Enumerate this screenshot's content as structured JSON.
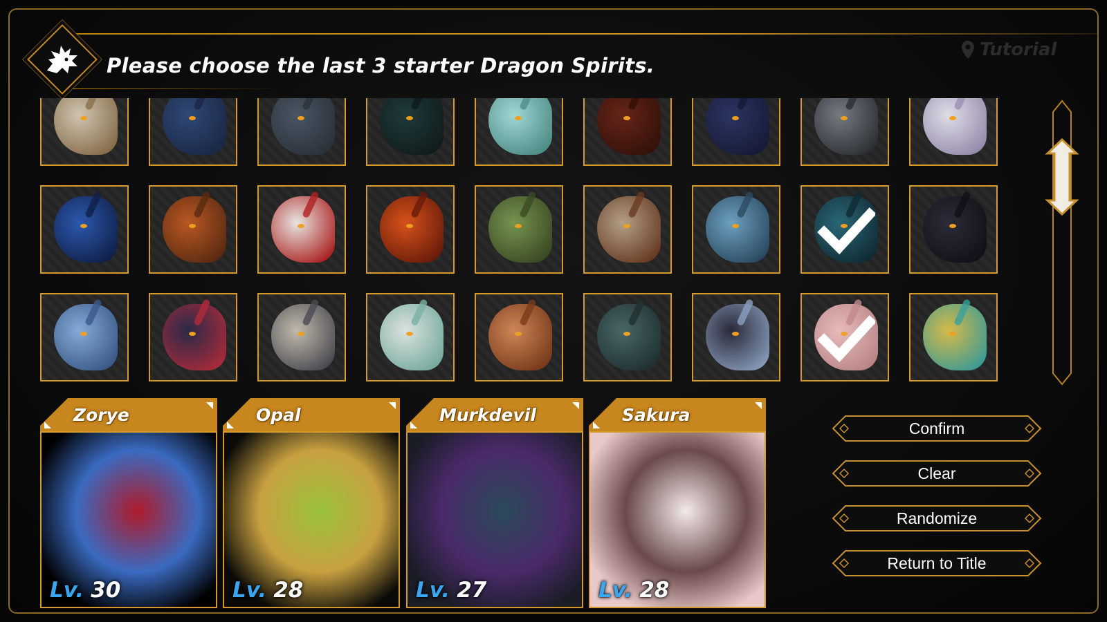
{
  "header": {
    "title": "Please choose the last 3 starter Dragon Spirits.",
    "tutorial_label": "Tutorial"
  },
  "grid": {
    "rows": [
      [
        {
          "name": "dragon-1-1",
          "palette": [
            "#d8cdb8",
            "#8a6f4a"
          ],
          "selected": false
        },
        {
          "name": "dragon-1-2",
          "palette": [
            "#2f4a7a",
            "#1a2746"
          ],
          "selected": false
        },
        {
          "name": "dragon-1-3",
          "palette": [
            "#4b5866",
            "#2a323b"
          ],
          "selected": false
        },
        {
          "name": "dragon-1-4",
          "palette": [
            "#1f3b3a",
            "#0f1a1c"
          ],
          "selected": false
        },
        {
          "name": "dragon-1-5",
          "palette": [
            "#a6e0dc",
            "#4f8f8a"
          ],
          "selected": false
        },
        {
          "name": "dragon-1-6",
          "palette": [
            "#6a2418",
            "#321008"
          ],
          "selected": false
        },
        {
          "name": "dragon-1-7",
          "palette": [
            "#2b3566",
            "#151a36"
          ],
          "selected": false
        },
        {
          "name": "dragon-1-8",
          "palette": [
            "#7a7f86",
            "#2b2f34"
          ],
          "selected": false
        },
        {
          "name": "dragon-1-9",
          "palette": [
            "#e8e6f0",
            "#9a8fb2"
          ],
          "selected": false
        }
      ],
      [
        {
          "name": "dragon-2-1",
          "palette": [
            "#2c5bb5",
            "#0f1f4a"
          ],
          "selected": false
        },
        {
          "name": "dragon-2-2",
          "palette": [
            "#c25a22",
            "#5a2a10"
          ],
          "selected": false
        },
        {
          "name": "dragon-2-3",
          "palette": [
            "#f2efea",
            "#b02020"
          ],
          "selected": false
        },
        {
          "name": "dragon-2-4",
          "palette": [
            "#e0541a",
            "#6a1a08"
          ],
          "selected": false
        },
        {
          "name": "dragon-2-5",
          "palette": [
            "#7a9a52",
            "#3a4a22"
          ],
          "selected": false
        },
        {
          "name": "dragon-2-6",
          "palette": [
            "#b9a68a",
            "#6a3a22"
          ],
          "selected": false
        },
        {
          "name": "dragon-2-7",
          "palette": [
            "#6fa6c8",
            "#2a4a62"
          ],
          "selected": false
        },
        {
          "name": "dragon-2-8",
          "palette": [
            "#2a6a7a",
            "#0f2a34"
          ],
          "selected": true
        },
        {
          "name": "dragon-2-9",
          "palette": [
            "#2c2c3a",
            "#0f0f16"
          ],
          "selected": false
        }
      ],
      [
        {
          "name": "dragon-3-1",
          "palette": [
            "#8ab2e0",
            "#3a5a8a"
          ],
          "selected": false
        },
        {
          "name": "dragon-3-2",
          "palette": [
            "#2a2a4a",
            "#b02a3a"
          ],
          "selected": false
        },
        {
          "name": "dragon-3-3",
          "palette": [
            "#c9c2b2",
            "#4a4a52"
          ],
          "selected": false
        },
        {
          "name": "dragon-3-4",
          "palette": [
            "#e4ecea",
            "#7ab0a2"
          ],
          "selected": false
        },
        {
          "name": "dragon-3-5",
          "palette": [
            "#d88a5a",
            "#7a3a1a"
          ],
          "selected": false
        },
        {
          "name": "dragon-3-6",
          "palette": [
            "#4a6a6a",
            "#1f2f30"
          ],
          "selected": false
        },
        {
          "name": "dragon-3-7",
          "palette": [
            "#2a2a3a",
            "#8aa0c0"
          ],
          "selected": false
        },
        {
          "name": "dragon-3-8",
          "palette": [
            "#f2c2c2",
            "#c08a8a"
          ],
          "selected": true
        },
        {
          "name": "dragon-3-9",
          "palette": [
            "#e0c24a",
            "#3aa09a"
          ],
          "selected": false
        }
      ]
    ]
  },
  "selected_cards": [
    {
      "name": "Zorye",
      "level_label": "Lv.",
      "level": "30",
      "bg": "#000000",
      "palette": [
        "#b01a2a",
        "#3a6ac0"
      ]
    },
    {
      "name": "Opal",
      "level_label": "Lv.",
      "level": "28",
      "bg": "#0a0a08",
      "palette": [
        "#9ac23a",
        "#c8a040"
      ]
    },
    {
      "name": "Murkdevil",
      "level_label": "Lv.",
      "level": "27",
      "bg": "#1a1c26",
      "palette": [
        "#2a4a5a",
        "#4a2a6a"
      ]
    },
    {
      "name": "Sakura",
      "level_label": "Lv.",
      "level": "28",
      "bg": "#e8c8c8",
      "palette": [
        "#f4eaea",
        "#6a4a4a"
      ]
    }
  ],
  "buttons": {
    "confirm": "Confirm",
    "clear": "Clear",
    "randomize": "Randomize",
    "return_to_title": "Return to Title"
  },
  "colors": {
    "accent_gold": "#d49a2c",
    "level_blue": "#3aa6f0",
    "text_white": "#ffffff"
  }
}
